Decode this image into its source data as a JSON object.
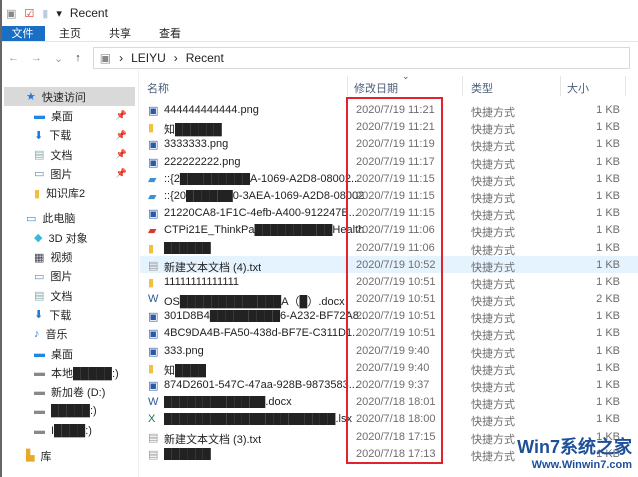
{
  "title": "Recent",
  "ribbon": {
    "tabs": [
      "文件",
      "主页",
      "共享",
      "查看"
    ]
  },
  "address": {
    "parts": [
      "LEIYU",
      "Recent"
    ]
  },
  "sidebar": {
    "items": [
      {
        "label": "快速访问",
        "icon": "star-icon",
        "head": true,
        "sel": true
      },
      {
        "label": "桌面",
        "icon": "desktop-icon",
        "pin": true
      },
      {
        "label": "下载",
        "icon": "download-icon",
        "pin": true
      },
      {
        "label": "文档",
        "icon": "document-icon",
        "pin": true
      },
      {
        "label": "图片",
        "icon": "pictures-icon",
        "pin": true
      },
      {
        "label": "知识库2",
        "icon": "folder-icon"
      },
      {
        "label": "此电脑",
        "icon": "computer-icon",
        "head": true
      },
      {
        "label": "3D 对象",
        "icon": "3d-objects-icon"
      },
      {
        "label": "视频",
        "icon": "video-icon"
      },
      {
        "label": "图片",
        "icon": "pictures-icon"
      },
      {
        "label": "文档",
        "icon": "document-icon"
      },
      {
        "label": "下载",
        "icon": "download-icon"
      },
      {
        "label": "音乐",
        "icon": "music-icon"
      },
      {
        "label": "桌面",
        "icon": "desktop-icon"
      },
      {
        "label": "本地█████:)",
        "icon": "drive-icon"
      },
      {
        "label": "新加卷 (D:)",
        "icon": "drive-icon"
      },
      {
        "label": "█████:)",
        "icon": "drive-icon"
      },
      {
        "label": "I████:)",
        "icon": "drive-icon"
      },
      {
        "label": "库",
        "icon": "library-icon",
        "head": true
      }
    ]
  },
  "columns": {
    "name": "名称",
    "date": "修改日期",
    "type": "类型",
    "size": "大小"
  },
  "files": [
    {
      "name": "444444444444.png",
      "icon": "image",
      "date": "2020/7/19 11:21",
      "type": "快捷方式",
      "size": "1 KB"
    },
    {
      "name": "知██████",
      "icon": "folder",
      "date": "2020/7/19 11:21",
      "type": "快捷方式",
      "size": "1 KB"
    },
    {
      "name": "3333333.png",
      "icon": "image",
      "date": "2020/7/19 11:19",
      "type": "快捷方式",
      "size": "1 KB"
    },
    {
      "name": "222222222.png",
      "icon": "image",
      "date": "2020/7/19 11:17",
      "type": "快捷方式",
      "size": "1 KB"
    },
    {
      "name": "::{2█████████A-1069-A2D8-08002...",
      "icon": "computer",
      "date": "2020/7/19 11:15",
      "type": "快捷方式",
      "size": "1 KB"
    },
    {
      "name": "::{20██████0-3AEA-1069-A2D8-08002...",
      "icon": "computer",
      "date": "2020/7/19 11:15",
      "type": "快捷方式",
      "size": "1 KB"
    },
    {
      "name": "21220CA8-1F1C-4efb-A400-912247B...",
      "icon": "image",
      "date": "2020/7/19 11:15",
      "type": "快捷方式",
      "size": "1 KB"
    },
    {
      "name": "CTPi21E_ThinkPa██████████Healthca...",
      "icon": "pdf",
      "date": "2020/7/19 11:06",
      "type": "快捷方式",
      "size": "1 KB"
    },
    {
      "name": "██████",
      "icon": "folder",
      "date": "2020/7/19 11:06",
      "type": "快捷方式",
      "size": "1 KB"
    },
    {
      "name": "新建文本文档 (4).txt",
      "icon": "text",
      "date": "2020/7/19 10:52",
      "type": "快捷方式",
      "size": "1 KB",
      "sel": true
    },
    {
      "name": "11111111111111",
      "icon": "folder",
      "date": "2020/7/19 10:51",
      "type": "快捷方式",
      "size": "1 KB"
    },
    {
      "name": "OS█████████████A（█）.docx",
      "icon": "word",
      "date": "2020/7/19 10:51",
      "type": "快捷方式",
      "size": "2 KB"
    },
    {
      "name": "301D8B4█████████6-A232-BF72A8...",
      "icon": "image",
      "date": "2020/7/19 10:51",
      "type": "快捷方式",
      "size": "1 KB"
    },
    {
      "name": "4BC9DA4B-FA50-438d-BF7E-C311D1...",
      "icon": "image",
      "date": "2020/7/19 10:51",
      "type": "快捷方式",
      "size": "1 KB"
    },
    {
      "name": "333.png",
      "icon": "image",
      "date": "2020/7/19 9:40",
      "type": "快捷方式",
      "size": "1 KB"
    },
    {
      "name": "知████",
      "icon": "folder",
      "date": "2020/7/19 9:40",
      "type": "快捷方式",
      "size": "1 KB"
    },
    {
      "name": "874D2601-547C-47aa-928B-9873583...",
      "icon": "image",
      "date": "2020/7/19 9:37",
      "type": "快捷方式",
      "size": "1 KB"
    },
    {
      "name": "█████████████.docx",
      "icon": "word",
      "date": "2020/7/18 18:01",
      "type": "快捷方式",
      "size": "1 KB"
    },
    {
      "name": "██████████████████████.lsx",
      "icon": "excel",
      "date": "2020/7/18 18:00",
      "type": "快捷方式",
      "size": "1 KB"
    },
    {
      "name": "新建文本文档 (3).txt",
      "icon": "text",
      "date": "2020/7/18 17:15",
      "type": "快捷方式",
      "size": "1 KB"
    },
    {
      "name": "██████",
      "icon": "text",
      "date": "2020/7/18 17:13",
      "type": "快捷方式",
      "size": "1 KB"
    }
  ],
  "watermark": {
    "line1": "Win7系统之家",
    "line2": "Www.Winwin7.com"
  }
}
